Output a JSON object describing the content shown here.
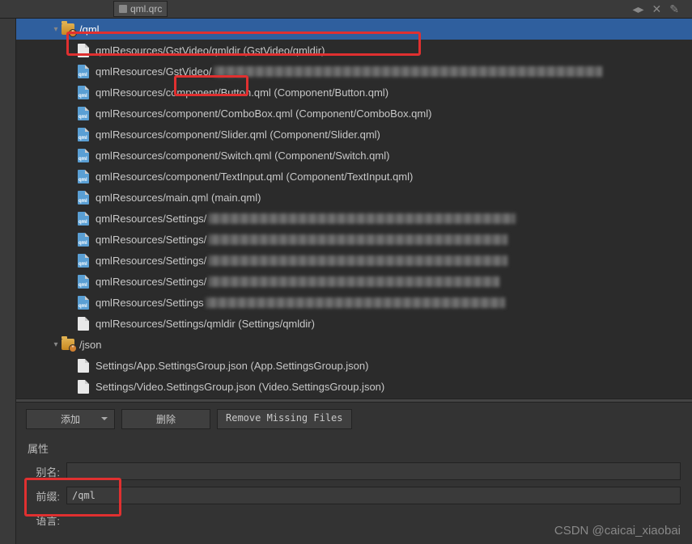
{
  "tab": {
    "title": "qml.qrc"
  },
  "toolicons": [
    "◂▸",
    "✕",
    "✎"
  ],
  "tree": {
    "qml": {
      "label": "/qml",
      "items": [
        {
          "icon": "plain",
          "text": "qmlResources/GstVideo/qmldir (GstVideo/qmldir)",
          "blur_w": 0
        },
        {
          "icon": "qml",
          "text": "qmlResources/GstVideo/",
          "blur_w": 480
        },
        {
          "icon": "qml",
          "text_pre": "qmlResources",
          "text_mid": "/component/",
          "text_post": "Button.qml (Component/Button.qml)"
        },
        {
          "icon": "qml",
          "text": "qmlResources/component/ComboBox.qml (Component/ComboBox.qml)",
          "blur_w": 0
        },
        {
          "icon": "qml",
          "text": "qmlResources/component/Slider.qml (Component/Slider.qml)",
          "blur_w": 0
        },
        {
          "icon": "qml",
          "text": "qmlResources/component/Switch.qml (Component/Switch.qml)",
          "blur_w": 0
        },
        {
          "icon": "qml",
          "text": "qmlResources/component/TextInput.qml (Component/TextInput.qml)",
          "blur_w": 0
        },
        {
          "icon": "qml",
          "text": "qmlResources/main.qml (main.qml)",
          "blur_w": 0
        },
        {
          "icon": "qml",
          "text": "qmlResources/Settings/",
          "blur_w": 380
        },
        {
          "icon": "qml",
          "text": "qmlResources/Settings/",
          "blur_w": 370
        },
        {
          "icon": "qml",
          "text": "qmlResources/Settings/",
          "blur_w": 370
        },
        {
          "icon": "qml",
          "text": "qmlResources/Settings/",
          "blur_w": 360
        },
        {
          "icon": "qml",
          "text": "qmlResources/Settings",
          "blur_w": 370
        },
        {
          "icon": "plain",
          "text": "qmlResources/Settings/qmldir (Settings/qmldir)",
          "blur_w": 0
        }
      ]
    },
    "json": {
      "label": "/json",
      "items": [
        {
          "icon": "plain",
          "text": "Settings/App.SettingsGroup.json (App.SettingsGroup.json)"
        },
        {
          "icon": "plain",
          "text": "Settings/Video.SettingsGroup.json (Video.SettingsGroup.json)"
        }
      ]
    }
  },
  "buttons": {
    "add": "添加",
    "delete": "删除",
    "remove_missing": "Remove Missing Files"
  },
  "props": {
    "section": "属性",
    "alias_label": "别名:",
    "alias_value": "",
    "prefix_label": "前缀:",
    "prefix_value": "/qml",
    "lang_label": "语言:"
  },
  "watermark": "CSDN @caicai_xiaobai",
  "highlights": {
    "row1": "qmlResources/GstVideo/qmldir highlighted",
    "component_word": "/component/ highlighted",
    "prefix_box": "prefix field highlighted"
  }
}
